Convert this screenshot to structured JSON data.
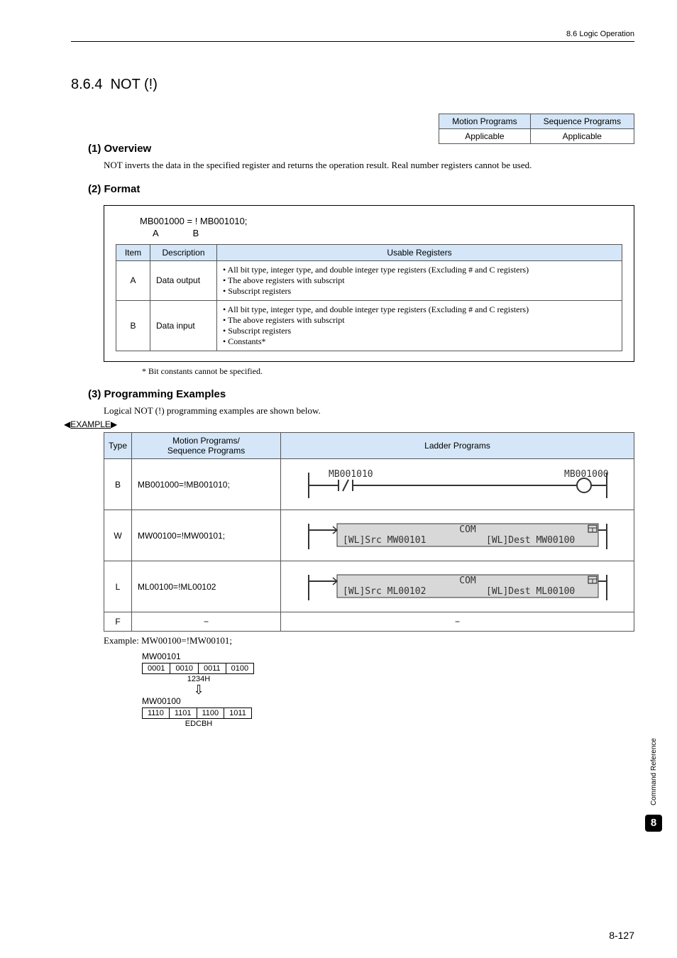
{
  "header": {
    "breadcrumb": "8.6  Logic Operation"
  },
  "section": {
    "number": "8.6.4",
    "title": "NOT (!)"
  },
  "applicability": {
    "h1": "Motion Programs",
    "h2": "Sequence Programs",
    "v1": "Applicable",
    "v2": "Applicable"
  },
  "overview": {
    "heading": "(1) Overview",
    "text": "NOT inverts the data in the specified register and returns the operation result. Real number registers cannot be used."
  },
  "format": {
    "heading": "(2) Format",
    "code": "MB001000 = ! MB001010;",
    "a": "A",
    "b": "B",
    "th_item": "Item",
    "th_desc": "Description",
    "th_reg": "Usable Registers",
    "rows": [
      {
        "item": "A",
        "desc": "Data output",
        "r1": "All bit type, integer type, and double integer type registers (Excluding # and C registers)",
        "r2": "The above registers with subscript",
        "r3": "Subscript registers"
      },
      {
        "item": "B",
        "desc": "Data input",
        "r1": "All bit type, integer type, and double integer type registers (Excluding # and C registers)",
        "r2": "The above registers with subscript",
        "r3": "Subscript registers",
        "r4": "Constants*"
      }
    ],
    "footnote": "*  Bit constants cannot be specified."
  },
  "examples": {
    "heading": "(3) Programming Examples",
    "text": "Logical NOT (!) programming examples are shown below.",
    "marker": "EXAMPLE",
    "th_type": "Type",
    "th_mp": "Motion Programs/\nSequence Programs",
    "th_lp": "Ladder Programs",
    "rows": [
      {
        "t": "B",
        "code": "MB001000=!MB001010;",
        "l_left": "MB001010",
        "l_right": "MB001000"
      },
      {
        "t": "W",
        "code": "MW00100=!MW00101;",
        "com": "COM",
        "src": "[WL]Src  MW00101",
        "dst": "[WL]Dest  MW00100"
      },
      {
        "t": "L",
        "code": "ML00100=!ML00102",
        "com": "COM",
        "src": "[WL]Src  ML00102",
        "dst": "[WL]Dest  ML00100"
      },
      {
        "t": "F",
        "code": "−",
        "ladder": "−"
      }
    ],
    "example_line": "Example: MW00100=!MW00101;"
  },
  "bits": {
    "label1": "MW00101",
    "cells1": [
      "0001",
      "0010",
      "0011",
      "0100"
    ],
    "hex1": "1234H",
    "label2": "MW00100",
    "cells2": [
      "1110",
      "1101",
      "1100",
      "1011"
    ],
    "hex2": "EDCBH"
  },
  "side": {
    "text": "Command Reference",
    "num": "8"
  },
  "page": "8-127"
}
